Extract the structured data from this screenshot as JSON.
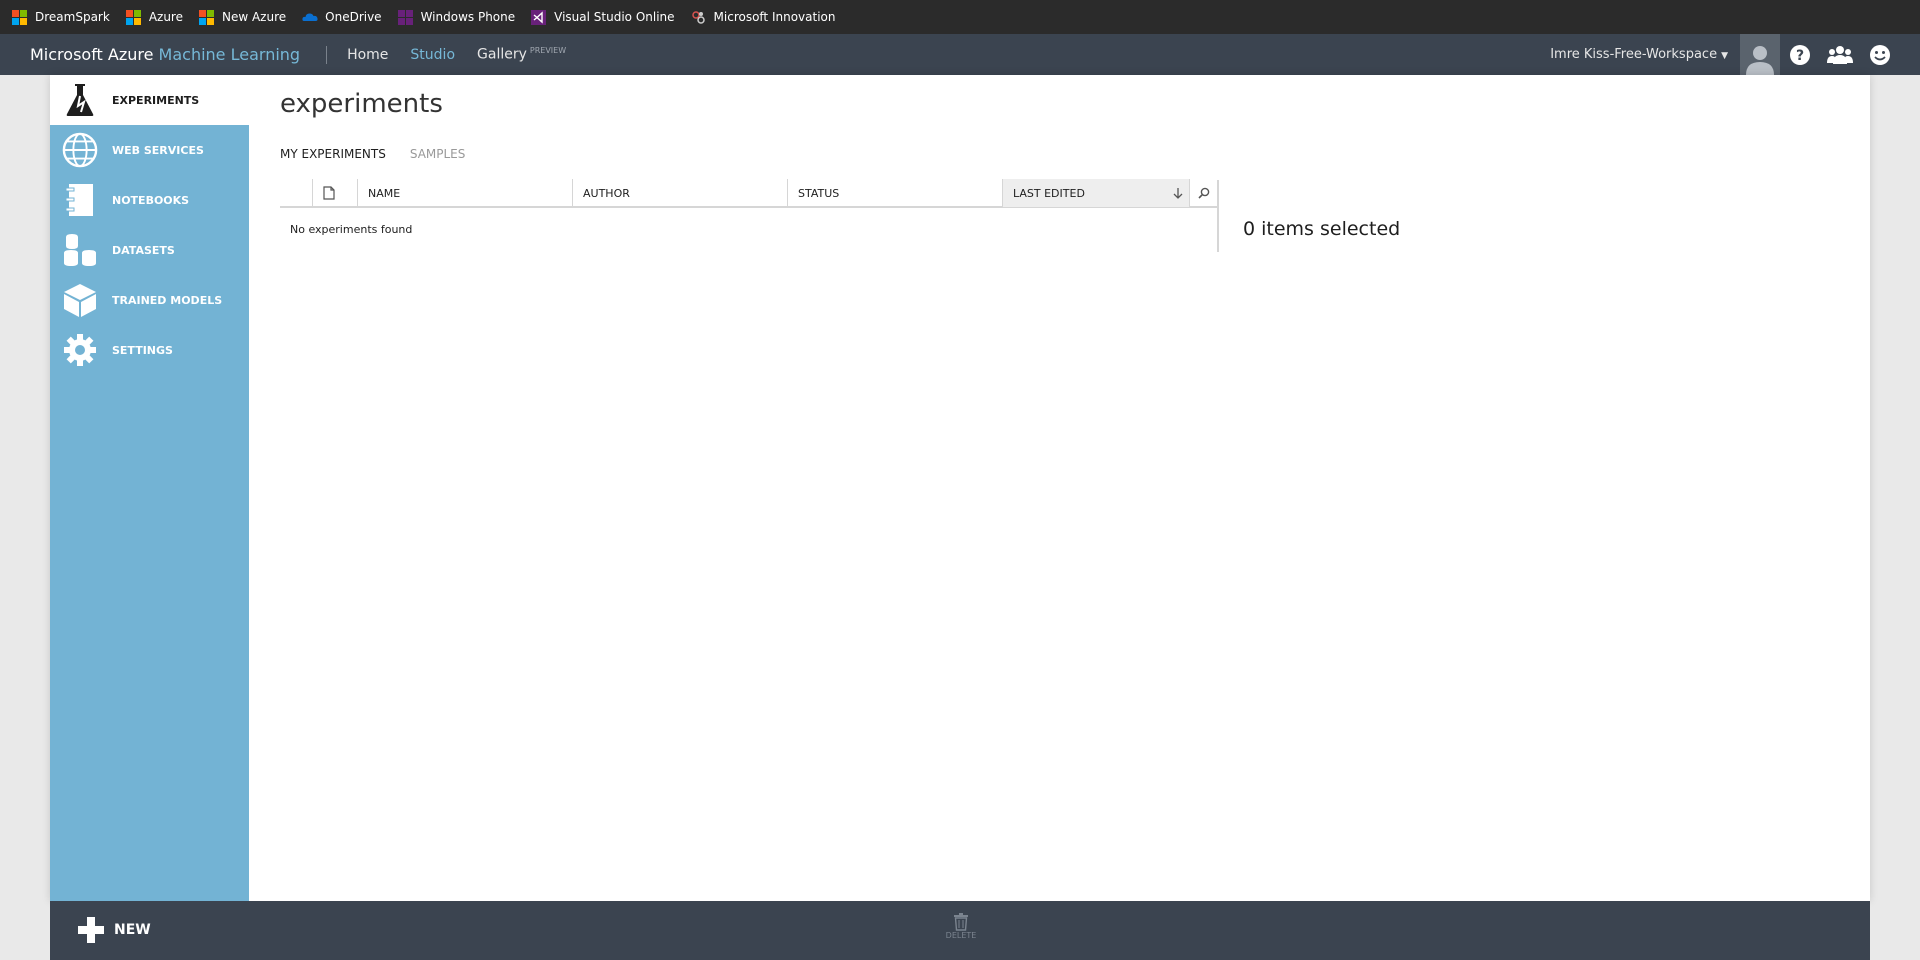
{
  "bookmarks": [
    {
      "label": "DreamSpark",
      "icon": "microsoft-logo-icon"
    },
    {
      "label": "Azure",
      "icon": "microsoft-logo-icon"
    },
    {
      "label": "New Azure",
      "icon": "microsoft-logo-icon"
    },
    {
      "label": "OneDrive",
      "icon": "onedrive-icon"
    },
    {
      "label": "Windows Phone",
      "icon": "windows-phone-icon"
    },
    {
      "label": "Visual Studio Online",
      "icon": "visual-studio-icon"
    },
    {
      "label": "Microsoft Innovation",
      "icon": "innovation-icon"
    }
  ],
  "header": {
    "brand_main": "Microsoft Azure ",
    "brand_accent": "Machine Learning",
    "nav": {
      "home": "Home",
      "studio": "Studio",
      "gallery": "Gallery",
      "gallery_badge": "PREVIEW"
    },
    "workspace": "Imre Kiss-Free-Workspace",
    "accent_color": "#76b8d7"
  },
  "sidebar": {
    "items": [
      {
        "label": "EXPERIMENTS",
        "icon": "flask-icon",
        "active": true
      },
      {
        "label": "WEB SERVICES",
        "icon": "globe-icon"
      },
      {
        "label": "NOTEBOOKS",
        "icon": "notebook-icon"
      },
      {
        "label": "DATASETS",
        "icon": "datasets-icon"
      },
      {
        "label": "TRAINED MODELS",
        "icon": "cube-icon"
      },
      {
        "label": "SETTINGS",
        "icon": "gear-icon"
      }
    ],
    "color": "#73b3d4"
  },
  "main": {
    "title": "experiments",
    "tabs": [
      {
        "label": "MY EXPERIMENTS",
        "active": true
      },
      {
        "label": "SAMPLES"
      }
    ],
    "grid": {
      "columns": [
        "NAME",
        "AUTHOR",
        "STATUS",
        "LAST EDITED"
      ],
      "empty_message": "No experiments found"
    },
    "selection": "0 items selected"
  },
  "bottombar": {
    "new_label": "NEW",
    "delete_label": "DELETE"
  }
}
